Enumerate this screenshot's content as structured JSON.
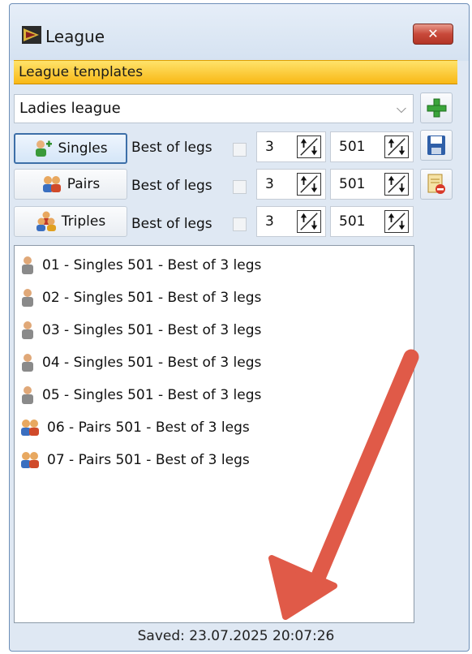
{
  "window": {
    "title": "League",
    "close_label": "✕"
  },
  "section_title": "League templates",
  "template_select": {
    "value": "Ladies league"
  },
  "modes": [
    {
      "label": "Singles",
      "mode_label": "Best of legs",
      "legs": "3",
      "points": "501",
      "selected": true
    },
    {
      "label": "Pairs",
      "mode_label": "Best of legs",
      "legs": "3",
      "points": "501",
      "selected": false
    },
    {
      "label": "Triples",
      "mode_label": "Best of legs",
      "legs": "3",
      "points": "501",
      "selected": false
    }
  ],
  "side_actions": [
    "add-icon",
    "save-icon",
    "delete-icon"
  ],
  "games": [
    {
      "icon": "single-player-icon",
      "label": "01 - Singles 501 - Best of 3 legs"
    },
    {
      "icon": "single-player-icon",
      "label": "02 - Singles 501 - Best of 3 legs"
    },
    {
      "icon": "single-player-icon",
      "label": "03 - Singles 501 - Best of 3 legs"
    },
    {
      "icon": "single-player-icon",
      "label": "04 - Singles 501 - Best of 3 legs"
    },
    {
      "icon": "single-player-icon",
      "label": "05 - Singles 501 - Best of 3 legs"
    },
    {
      "icon": "pair-players-icon",
      "label": "06 - Pairs 501 - Best of 3 legs"
    },
    {
      "icon": "pair-players-icon",
      "label": "07 - Pairs 501 - Best of 3 legs"
    }
  ],
  "status_text": "Saved: 23.07.2025 20:07:26",
  "colors": {
    "section_bar": "#f8b815",
    "arrow": "#e05a48",
    "close": "#c8493a"
  }
}
